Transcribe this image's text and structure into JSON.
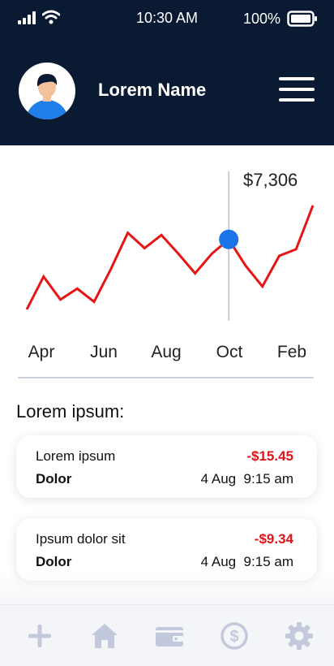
{
  "status_bar": {
    "time": "10:30 AM",
    "battery_percent": "100%",
    "icons": [
      "signal-icon",
      "wifi-icon",
      "battery-icon"
    ]
  },
  "header": {
    "profile_name": "Lorem Name",
    "icons": [
      "avatar-icon",
      "hamburger-menu-icon"
    ]
  },
  "chart_data": {
    "type": "line",
    "x": [
      0,
      1,
      2,
      3,
      4,
      5,
      6,
      7,
      8,
      9,
      10,
      11,
      12,
      13,
      14,
      15,
      16,
      17
    ],
    "values": [
      1,
      4,
      1.9,
      2.9,
      1.7,
      4.7,
      8,
      6.6,
      7.8,
      6.1,
      4.3,
      6.1,
      7.4,
      5,
      3.1,
      5.9,
      6.5,
      10.5
    ],
    "x_tick_labels": [
      "Apr",
      "Jun",
      "Aug",
      "Oct",
      "Feb"
    ],
    "highlight": {
      "index": 12,
      "label": "$7,306"
    },
    "series_color": "#e81414",
    "marker_color": "#1a73e8",
    "grid": false
  },
  "transactions": {
    "section_title": "Lorem ipsum:",
    "items": [
      {
        "title": "Lorem ipsum",
        "subtitle": "Dolor",
        "amount": "-$15.45",
        "date": "4 Aug  9:15 am"
      },
      {
        "title": "Ipsum dolor sit",
        "subtitle": "Dolor",
        "amount": "-$9.34",
        "date": "4 Aug  9:15 am"
      }
    ]
  },
  "tab_bar": {
    "icon_color": "#c3c9dc",
    "tabs": [
      "plus-icon",
      "home-icon",
      "wallet-icon",
      "dollar-coin-icon",
      "settings-gear-icon"
    ]
  },
  "colors": {
    "header_bg": "#0b1a33",
    "amount_negative": "#e0131b"
  }
}
